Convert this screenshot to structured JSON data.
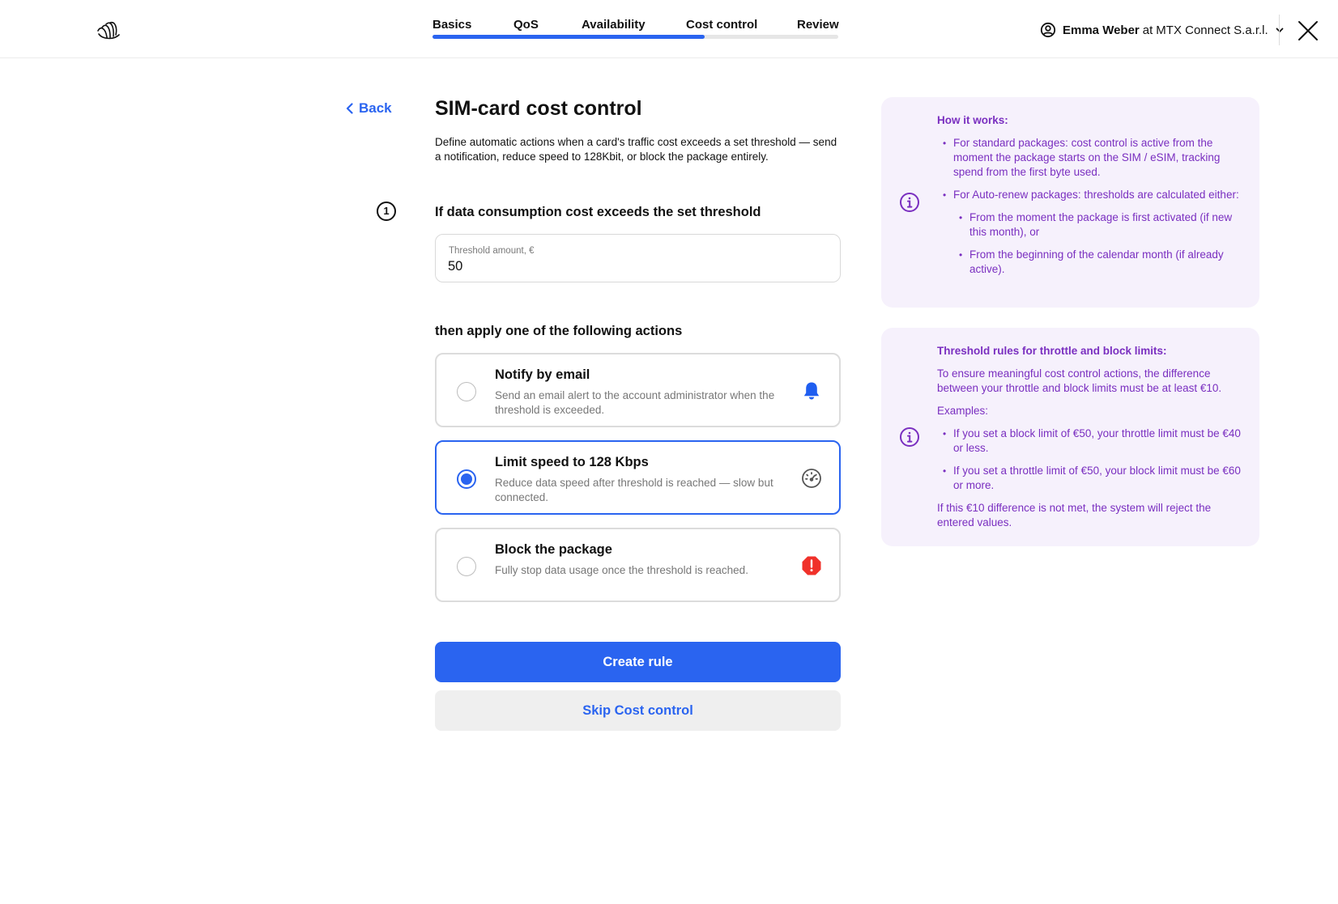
{
  "header": {
    "steps": [
      {
        "label": "Basics"
      },
      {
        "label": "QoS"
      },
      {
        "label": "Availability"
      },
      {
        "label": "Cost control"
      },
      {
        "label": "Review"
      }
    ],
    "progress_fraction": 0.67,
    "user": {
      "name": "Emma Weber",
      "at_text": "at",
      "company": "MTX Connect S.a.r.l."
    }
  },
  "nav": {
    "back_label": "Back"
  },
  "main": {
    "title": "SIM-card cost control",
    "description": "Define automatic actions when a card's traffic cost exceeds a set threshold — send a notification, reduce speed to 128Kbit, or block the package entirely.",
    "step_number": "1",
    "threshold_section_title": "If data consumption cost exceeds the set threshold",
    "threshold_field": {
      "label": "Threshold amount, €",
      "value": "50"
    },
    "actions_title": "then apply one of the following actions",
    "options": [
      {
        "title": "Notify by email",
        "description": "Send an email alert to the account administrator when the threshold is exceeded.",
        "icon": "bell-icon",
        "selected": false
      },
      {
        "title": "Limit speed to 128 Kbps",
        "description": "Reduce data speed after threshold is reached — slow but connected.",
        "icon": "speedometer-icon",
        "selected": true
      },
      {
        "title": "Block the package",
        "description": "Fully stop data usage once the threshold is reached.",
        "icon": "alert-octagon-icon",
        "selected": false
      }
    ],
    "primary_button": "Create rule",
    "secondary_button": "Skip Cost control"
  },
  "info_how": {
    "title": "How it works:",
    "items": [
      "For standard packages: cost control is active from the moment the package starts on the SIM / eSIM, tracking spend from the first byte used.",
      "For Auto-renew packages: thresholds are calculated either:"
    ],
    "sub_items": [
      "From the moment the package is first activated (if new this month), or",
      "From the beginning of the calendar month (if already active)."
    ]
  },
  "info_rules": {
    "title": "Threshold rules for throttle and block limits:",
    "intro": "To ensure meaningful cost control actions, the difference between your throttle and block limits must be at least €10.",
    "examples_label": "Examples:",
    "items": [
      "If you set a block limit of €50, your throttle limit must be €40 or less.",
      "If you set a throttle limit of €50, your block limit must be €60 or more."
    ],
    "footer": "If this €10 difference is not met, the system will reject the entered values."
  },
  "colors": {
    "accent": "#2a64f0",
    "info_text": "#7a2fc0",
    "info_bg": "#f6f1fc",
    "danger": "#f0312a"
  }
}
